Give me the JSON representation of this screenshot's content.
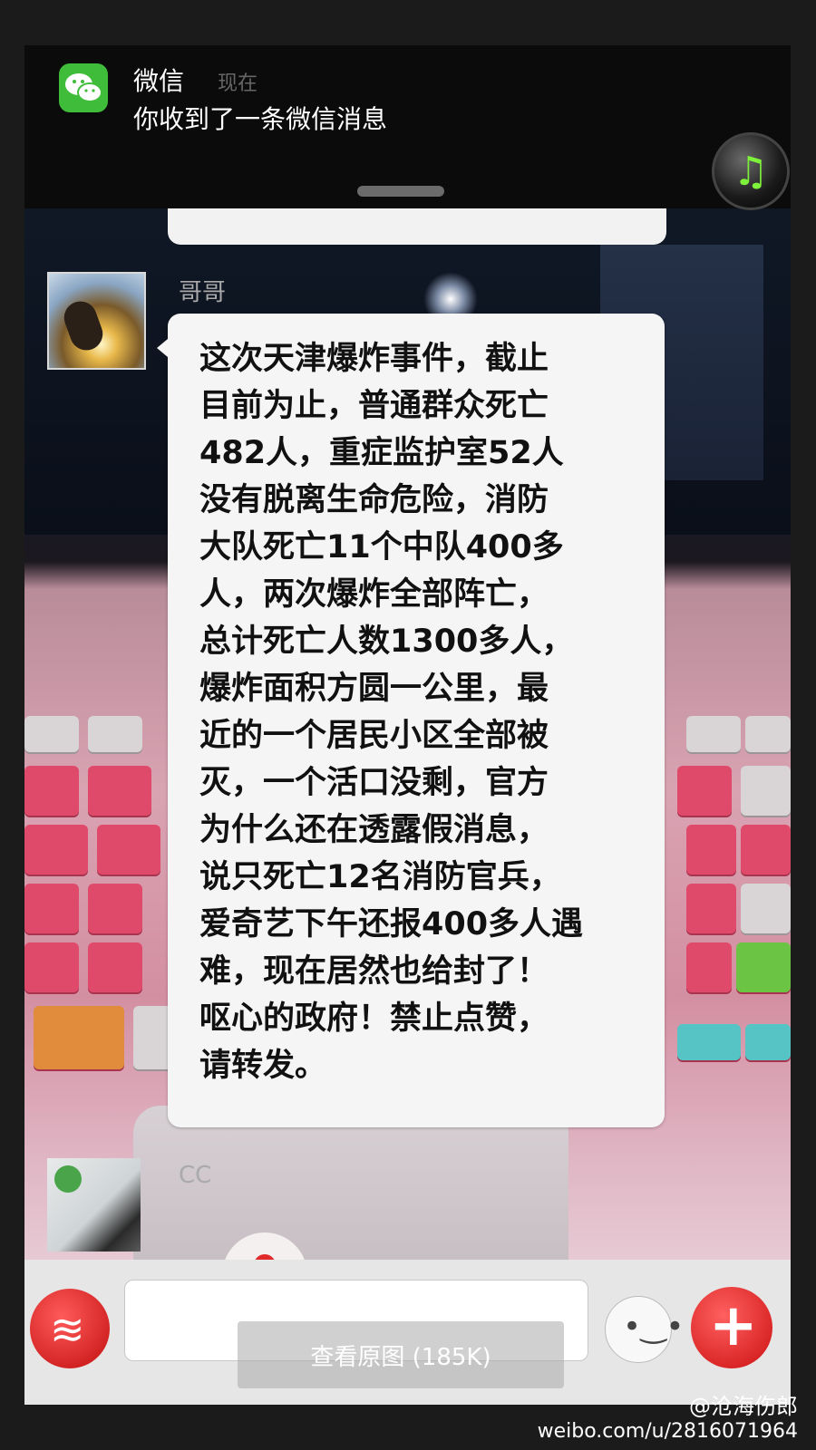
{
  "notification": {
    "app_name": "微信",
    "time": "现在",
    "message": "你收到了一条微信消息",
    "app_icon": "wechat-icon"
  },
  "music_icon": "music-note-icon",
  "chat": {
    "messages": [
      {
        "sender": "哥哥",
        "text": "这次天津爆炸事件，截止\n目前为止，普通群众死亡\n482人，重症监护室52人\n没有脱离生命危险，消防\n大队死亡11个中队400多\n人，两次爆炸全部阵亡，\n总计死亡人数1300多人，\n爆炸面积方圆一公里，最\n近的一个居民小区全部被\n灭，一个活口没剩，官方\n为什么还在透露假消息，\n说只死亡12名消防官兵，\n爱奇艺下午还报400多人遇\n难，现在居然也给封了！\n呕心的政府！禁止点赞，\n请转发。"
      },
      {
        "sender": "CC"
      }
    ]
  },
  "input_bar": {
    "left_button_icon": "voice-icon",
    "emoji_button_icon": "emoji-icon",
    "plus_button_icon": "plus-icon"
  },
  "overlay": {
    "view_original": "查看原图 (185K)"
  },
  "watermark": {
    "handle": "@沧海伤郎",
    "url": "weibo.com/u/2816071964"
  },
  "colors": {
    "wechat_green": "#3fbd3a",
    "accent_red": "#d21a1a",
    "bubble_bg": "#f5f5f5"
  }
}
